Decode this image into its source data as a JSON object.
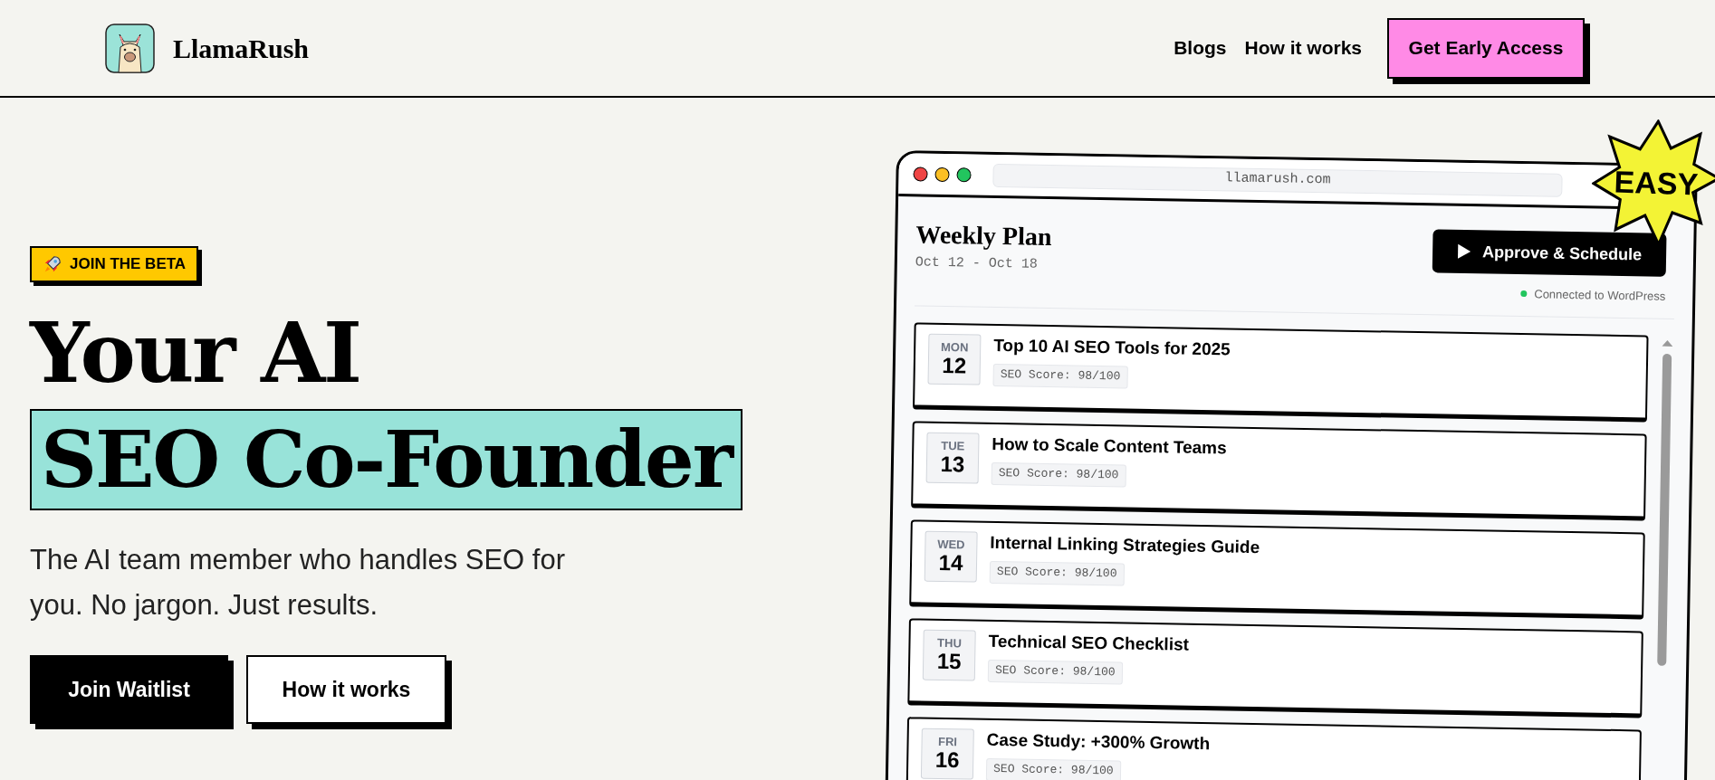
{
  "header": {
    "brand": "LlamaRush",
    "nav": [
      {
        "label": "Blogs"
      },
      {
        "label": "How it works"
      }
    ],
    "cta": "Get Early Access"
  },
  "hero": {
    "badge": "JOIN THE BETA",
    "headline": "Your AI",
    "headline_highlight": "SEO Co-Founder",
    "subtitle": "The AI team member who handles SEO for you. No jargon. Just results.",
    "buttons": [
      {
        "label": "Join Waitlist",
        "kind": "primary"
      },
      {
        "label": "How it works",
        "kind": "secondary"
      }
    ]
  },
  "preview": {
    "url": "llamarush.com",
    "sticker": "EASY",
    "title": "Weekly Plan",
    "date_range": "Oct 12 - Oct 18",
    "approve_button": "Approve & Schedule",
    "status": "Connected to WordPress",
    "posts": [
      {
        "day": "MON",
        "date": "12",
        "title": "Top 10 AI SEO Tools for 2025",
        "score": "SEO Score: 98/100"
      },
      {
        "day": "TUE",
        "date": "13",
        "title": "How to Scale Content Teams",
        "score": "SEO Score: 98/100"
      },
      {
        "day": "WED",
        "date": "14",
        "title": "Internal Linking Strategies Guide",
        "score": "SEO Score: 98/100"
      },
      {
        "day": "THU",
        "date": "15",
        "title": "Technical SEO Checklist",
        "score": "SEO Score: 98/100"
      },
      {
        "day": "FRI",
        "date": "16",
        "title": "Case Study: +300% Growth",
        "score": "SEO Score: 98/100"
      }
    ]
  }
}
